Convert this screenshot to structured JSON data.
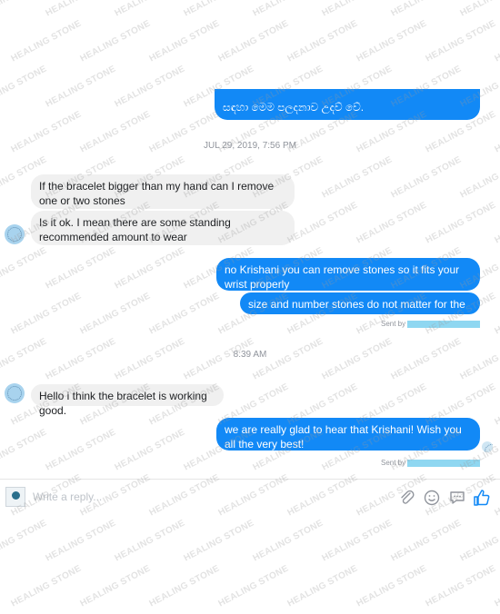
{
  "conversation": {
    "top_bubble_text": "සඳහා මෙම පලදනාව උදව් වේ.",
    "timestamps": [
      "JUL 29, 2019, 7:56 PM",
      "8:39 AM"
    ],
    "messages": [
      {
        "side": "in",
        "text": "If the bracelet bigger than my hand can I remove one or two stones"
      },
      {
        "side": "in",
        "text": "Is it ok. I mean there are some standing recommended amount to wear"
      },
      {
        "side": "out",
        "text": "no Krishani you can remove stones so it fits your wrist properly"
      },
      {
        "side": "out",
        "text": "size and number stones do not matter for the effects"
      },
      {
        "side": "in",
        "text": "Hello i think the bracelet is working good."
      },
      {
        "side": "out",
        "text": "we are really glad to hear that Krishani! Wish you all the very best!"
      }
    ],
    "sent_by_label": "Sent by"
  },
  "composer": {
    "placeholder": "Write a reply...",
    "icons": [
      "attachment-icon",
      "emoji-icon",
      "sticker-icon",
      "thumbs-up-icon"
    ]
  },
  "watermark": "HEALING STONE",
  "colors": {
    "outgoing_bubble": "#1289f6",
    "incoming_bubble": "#f0f0f0",
    "like_icon": "#1289f6"
  }
}
